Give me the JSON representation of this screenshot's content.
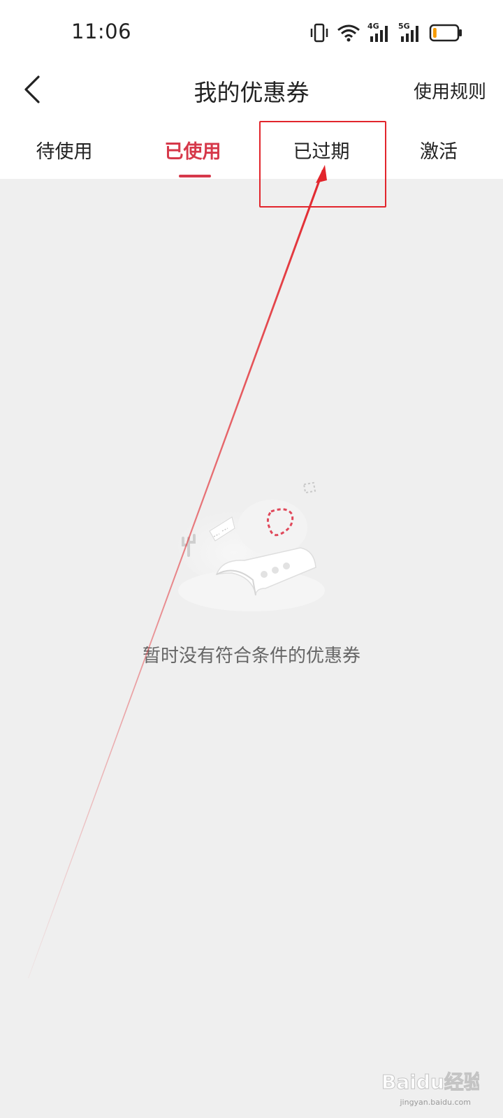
{
  "status_bar": {
    "time": "11:06",
    "icons": [
      "vibrate-icon",
      "wifi-icon",
      "4g-signal-icon",
      "5g-signal-icon",
      "battery-icon"
    ],
    "network_labels": [
      "4G",
      "5G"
    ],
    "battery_level": 0.15,
    "battery_color": "#f59a00"
  },
  "header": {
    "back_icon": "chevron-left-icon",
    "title": "我的优惠券",
    "rules_label": "使用规则"
  },
  "tabs": [
    {
      "label": "待使用",
      "active": false
    },
    {
      "label": "已使用",
      "active": true
    },
    {
      "label": "已过期",
      "active": false
    },
    {
      "label": "激活",
      "active": false
    }
  ],
  "empty_state": {
    "illustration": "empty-coupon-illustration",
    "message": "暂时没有符合条件的优惠券"
  },
  "annotation": {
    "color": "#e2252c",
    "highlighted_tab": "已过期"
  },
  "watermark": {
    "brand": "Baidu经验",
    "site": "jingyan.baidu.com"
  },
  "colors": {
    "accent": "#d6384a",
    "background": "#efefef",
    "surface": "#ffffff"
  }
}
